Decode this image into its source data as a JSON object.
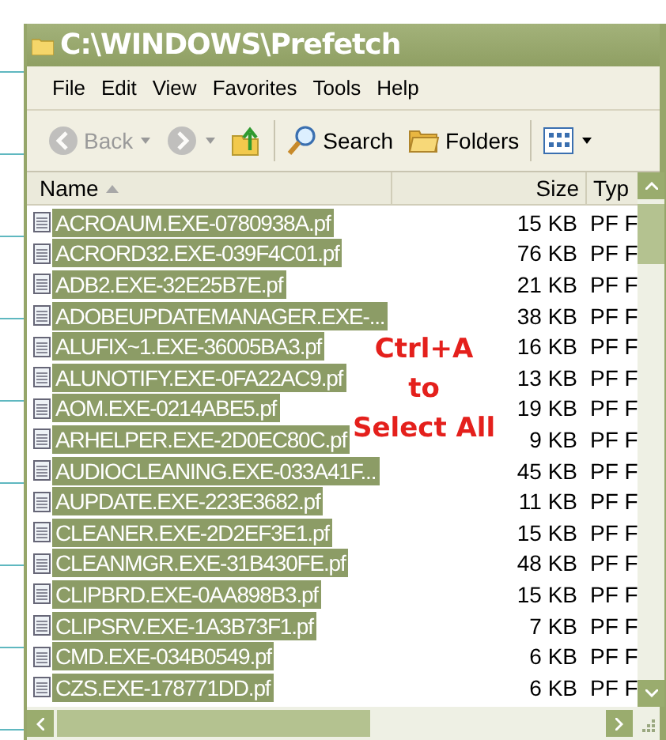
{
  "window": {
    "title": "C:\\WINDOWS\\Prefetch"
  },
  "menu": [
    "File",
    "Edit",
    "View",
    "Favorites",
    "Tools",
    "Help"
  ],
  "toolbar": [
    {
      "kind": "back",
      "label": "Back",
      "disabled": true,
      "dropdown": true
    },
    {
      "kind": "forward",
      "disabled": true,
      "dropdown": true
    },
    {
      "kind": "up",
      "disabled": false,
      "dropdown": false
    },
    {
      "kind": "search",
      "label": "Search",
      "disabled": false,
      "dropdown": false
    },
    {
      "kind": "folders",
      "label": "Folders",
      "disabled": false,
      "dropdown": false
    },
    {
      "kind": "views",
      "disabled": false,
      "dropdown": true
    }
  ],
  "columns": [
    {
      "label": "Name",
      "sorted": true
    },
    {
      "label": "Size",
      "sorted": false
    },
    {
      "label": "Typ",
      "sorted": false
    }
  ],
  "files": [
    {
      "name": "ACROAUM.EXE-0780938A.pf",
      "size": "15 KB",
      "type": "PF F",
      "selected": true
    },
    {
      "name": "ACRORD32.EXE-039F4C01.pf",
      "size": "76 KB",
      "type": "PF F",
      "selected": true
    },
    {
      "name": "ADB2.EXE-32E25B7E.pf",
      "size": "21 KB",
      "type": "PF F",
      "selected": true
    },
    {
      "name": "ADOBEUPDATEMANAGER.EXE-...",
      "size": "38 KB",
      "type": "PF F",
      "selected": true
    },
    {
      "name": "ALUFIX~1.EXE-36005BA3.pf",
      "size": "16 KB",
      "type": "PF F",
      "selected": true
    },
    {
      "name": "ALUNOTIFY.EXE-0FA22AC9.pf",
      "size": "13 KB",
      "type": "PF F",
      "selected": true
    },
    {
      "name": "AOM.EXE-0214ABE5.pf",
      "size": "19 KB",
      "type": "PF F",
      "selected": true
    },
    {
      "name": "ARHELPER.EXE-2D0EC80C.pf",
      "size": "9 KB",
      "type": "PF F",
      "selected": true
    },
    {
      "name": "AUDIOCLEANING.EXE-033A41F...",
      "size": "45 KB",
      "type": "PF F",
      "selected": true
    },
    {
      "name": "AUPDATE.EXE-223E3682.pf",
      "size": "11 KB",
      "type": "PF F",
      "selected": true
    },
    {
      "name": "CLEANER.EXE-2D2EF3E1.pf",
      "size": "15 KB",
      "type": "PF F",
      "selected": true
    },
    {
      "name": "CLEANMGR.EXE-31B430FE.pf",
      "size": "48 KB",
      "type": "PF F",
      "selected": true
    },
    {
      "name": "CLIPBRD.EXE-0AA898B3.pf",
      "size": "15 KB",
      "type": "PF F",
      "selected": true
    },
    {
      "name": "CLIPSRV.EXE-1A3B73F1.pf",
      "size": "7 KB",
      "type": "PF F",
      "selected": true
    },
    {
      "name": "CMD.EXE-034B0549.pf",
      "size": "6 KB",
      "type": "PF F",
      "selected": true
    },
    {
      "name": "CZS.EXE-178771DD.pf",
      "size": "6 KB",
      "type": "PF F",
      "selected": true
    }
  ],
  "annotation": {
    "lines": [
      "Ctrl+A",
      "to",
      "Select All"
    ]
  }
}
